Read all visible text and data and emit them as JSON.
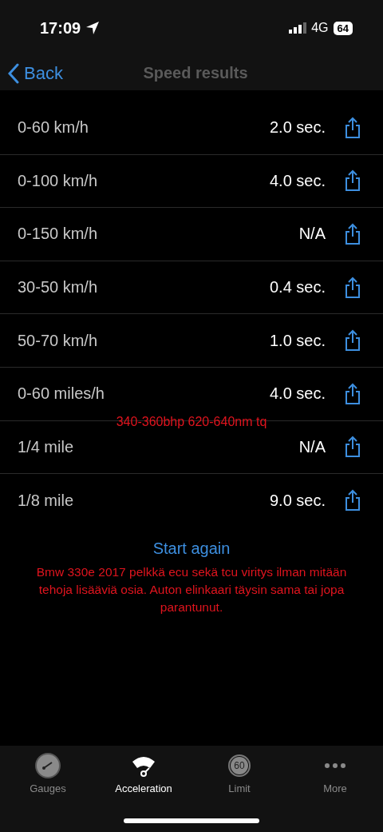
{
  "status_bar": {
    "time": "17:09",
    "network": "4G",
    "battery": "64"
  },
  "nav": {
    "back": "Back",
    "title": "Speed results"
  },
  "results": [
    {
      "label": "0-60 km/h",
      "value": "2.0 sec."
    },
    {
      "label": "0-100 km/h",
      "value": "4.0 sec."
    },
    {
      "label": "0-150 km/h",
      "value": "N/A"
    },
    {
      "label": "30-50 km/h",
      "value": "0.4 sec."
    },
    {
      "label": "50-70 km/h",
      "value": "1.0 sec."
    },
    {
      "label": "0-60 miles/h",
      "value": "4.0 sec."
    },
    {
      "label": "1/4 mile",
      "value": "N/A",
      "note": "340-360bhp 620-640nm tq"
    },
    {
      "label": "1/8 mile",
      "value": "9.0 sec."
    }
  ],
  "start_again": "Start again",
  "comment": "Bmw 330e 2017 pelkkä ecu sekä tcu viritys ilman mitään tehoja lisääviä osia. Auton elinkaari täysin sama tai jopa parantunut.",
  "tabs": [
    {
      "kind": "gauges",
      "label": "Gauges",
      "selected": false
    },
    {
      "kind": "acceleration",
      "label": "Acceleration",
      "selected": true
    },
    {
      "kind": "limit",
      "label": "Limit",
      "badge": "60",
      "selected": false
    },
    {
      "kind": "more",
      "label": "More",
      "selected": false
    }
  ]
}
